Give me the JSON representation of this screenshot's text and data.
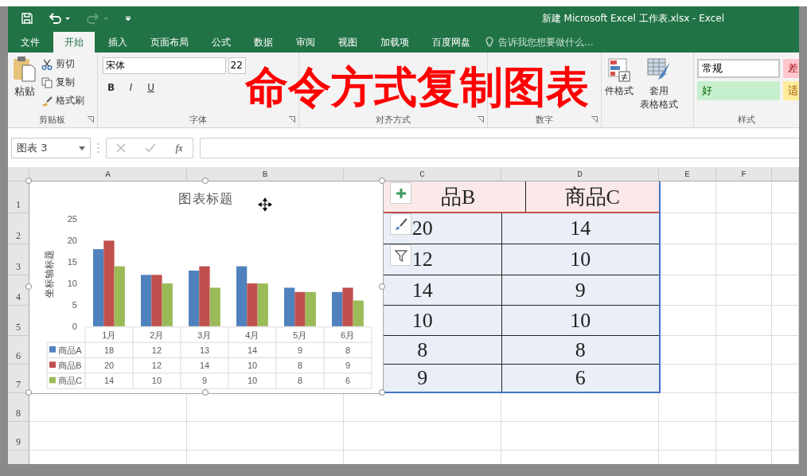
{
  "window": {
    "title": "新建 Microsoft Excel 工作表.xlsx - Excel"
  },
  "quick_access": [
    {
      "kind": "save",
      "disabled": false
    },
    {
      "kind": "undo",
      "disabled": false
    },
    {
      "kind": "redo",
      "disabled": true
    },
    {
      "kind": "customize",
      "disabled": false
    }
  ],
  "tabs": [
    {
      "label": "文件",
      "selected": false
    },
    {
      "label": "开始",
      "selected": true
    },
    {
      "label": "插入",
      "selected": false
    },
    {
      "label": "页面布局",
      "selected": false
    },
    {
      "label": "公式",
      "selected": false
    },
    {
      "label": "数据",
      "selected": false
    },
    {
      "label": "审阅",
      "selected": false
    },
    {
      "label": "视图",
      "selected": false
    },
    {
      "label": "加载项",
      "selected": false
    },
    {
      "label": "百度网盘",
      "selected": false
    }
  ],
  "tell_me": {
    "placeholder": "告诉我您想要做什么..."
  },
  "overlay_title": "命令方式复制图表",
  "ribbon": {
    "clipboard": {
      "paste": "粘贴",
      "cut": "剪切",
      "copy": "复制",
      "format_painter": "格式刷",
      "label": "剪贴板"
    },
    "font": {
      "name": "宋体",
      "size": "22",
      "buttons": [
        "B",
        "I",
        "U"
      ],
      "label": "字体"
    },
    "alignment": {
      "label": "对齐方式"
    },
    "number": {
      "label": "数字"
    },
    "conditional_format": {
      "label": "件格式"
    },
    "table_format": {
      "label_line_1": "套用",
      "label_line_2": "表格格式"
    },
    "styles": {
      "label": "样式",
      "cells": [
        {
          "label": "常规",
          "kind": "normal"
        },
        {
          "label": "差",
          "kind": "bad"
        },
        {
          "label": "好",
          "kind": "good"
        },
        {
          "label": "适",
          "kind": "neutral"
        }
      ]
    }
  },
  "formula_bar": {
    "name_box": "图表 3",
    "fx": "fx"
  },
  "sheet": {
    "columns": [
      "A",
      "B",
      "C",
      "D",
      "E",
      "F"
    ],
    "rows": [
      "1",
      "2",
      "3",
      "4",
      "5",
      "6",
      "7",
      "8",
      "9"
    ]
  },
  "table": {
    "header": [
      "品B",
      "商品C"
    ],
    "rows": [
      [
        "20",
        "14"
      ],
      [
        "12",
        "10"
      ],
      [
        "14",
        "9"
      ],
      [
        "10",
        "10"
      ],
      [
        "8",
        "8"
      ],
      [
        "9",
        "6"
      ]
    ]
  },
  "chart": {
    "selected": true,
    "data_table": [
      [
        "18",
        "12",
        "13",
        "14",
        "9",
        "8"
      ],
      [
        "20",
        "12",
        "14",
        "10",
        "8",
        "9"
      ],
      [
        "14",
        "10",
        "9",
        "10",
        "8",
        "6"
      ]
    ],
    "chart_data": {
      "type": "bar",
      "legend": true,
      "title": "图表标题",
      "ylabel": "坐标轴标题",
      "categories": [
        "1月",
        "2月",
        "3月",
        "4月",
        "5月",
        "6月"
      ],
      "ylim": [
        0,
        25
      ],
      "yticks": [
        0,
        5,
        10,
        15,
        20,
        25
      ],
      "series": [
        {
          "name": "商品A",
          "color": "#4f81bd",
          "values": [
            18,
            12,
            13,
            14,
            9,
            8
          ]
        },
        {
          "name": "商品B",
          "color": "#c0504d",
          "values": [
            20,
            12,
            14,
            10,
            8,
            9
          ]
        },
        {
          "name": "商品C",
          "color": "#9bbb59",
          "values": [
            14,
            10,
            9,
            10,
            8,
            6
          ]
        }
      ]
    }
  }
}
